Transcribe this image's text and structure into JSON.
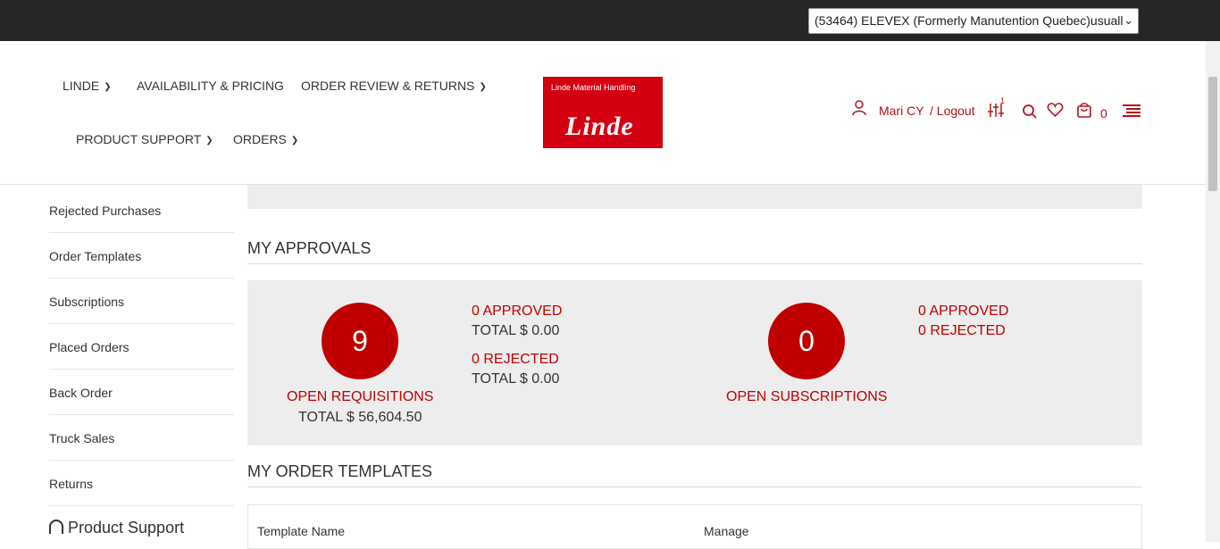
{
  "topbar": {
    "account_select": "(53464) ELEVEX (Formerly Manutention Quebec)usuall"
  },
  "nav": {
    "items": [
      {
        "label": "LINDE"
      },
      {
        "label": "AVAILABILITY & PRICING"
      },
      {
        "label": "ORDER REVIEW & RETURNS"
      },
      {
        "label": "PRODUCT SUPPORT"
      },
      {
        "label": "ORDERS"
      }
    ]
  },
  "logo": {
    "small": "Linde Material Handling",
    "big": "Linde"
  },
  "user": {
    "name": "Mari CY",
    "logout": "/ Logout",
    "filter_badge": "1",
    "cart_count": "0"
  },
  "sidebar": {
    "items": [
      {
        "label": "Rejected Purchases"
      },
      {
        "label": "Order Templates"
      },
      {
        "label": "Subscriptions"
      },
      {
        "label": "Placed Orders"
      },
      {
        "label": "Back Order"
      },
      {
        "label": "Truck Sales"
      },
      {
        "label": "Returns"
      }
    ],
    "product_support": "Product Support"
  },
  "approvals": {
    "title": "MY APPROVALS",
    "requisitions": {
      "count": "9",
      "label": "OPEN REQUISITIONS",
      "total": "TOTAL $ 56,604.50",
      "approved": "0 APPROVED",
      "approved_total": "TOTAL $ 0.00",
      "rejected": "0 REJECTED",
      "rejected_total": "TOTAL $ 0.00"
    },
    "subscriptions": {
      "count": "0",
      "label": "OPEN SUBSCRIPTIONS",
      "approved": "0 APPROVED",
      "rejected": "0 REJECTED"
    }
  },
  "templates": {
    "title": "MY ORDER TEMPLATES",
    "columns": [
      "Template Name",
      "Manage"
    ]
  },
  "colors": {
    "accent": "#c00000",
    "topbar": "#262626",
    "panel": "#ededed"
  }
}
